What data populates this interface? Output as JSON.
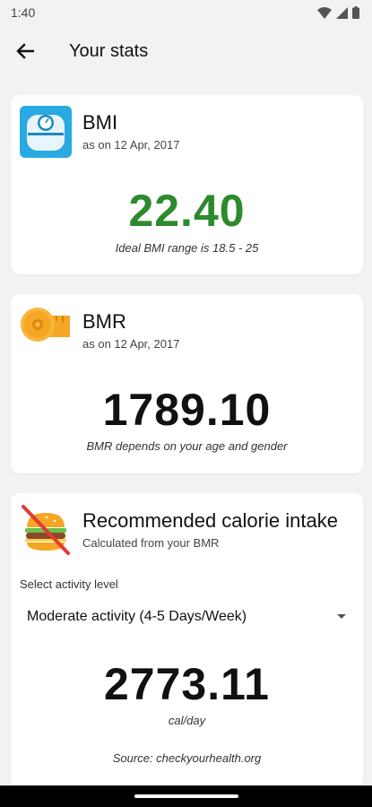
{
  "status_bar": {
    "time": "1:40"
  },
  "app_bar": {
    "title": "Your stats"
  },
  "bmi": {
    "title": "BMI",
    "date": "as on 12 Apr, 2017",
    "value": "22.40",
    "caption": "Ideal BMI range is 18.5 - 25",
    "value_color": "#2d8a2d"
  },
  "bmr": {
    "title": "BMR",
    "date": "as on 12 Apr, 2017",
    "value": "1789.10",
    "caption": "BMR depends on your age and gender"
  },
  "calorie": {
    "title": "Recommended calorie intake",
    "subtitle": "Calculated from your BMR",
    "select_label": "Select activity level",
    "activity": "Moderate activity (4-5 Days/Week)",
    "value": "2773.11",
    "unit": "cal/day",
    "source": "Source: checkyourhealth.org"
  },
  "icons": {
    "back": "arrow-back-icon",
    "bmi": "weighing-scale-icon",
    "bmr": "measuring-tape-icon",
    "calorie": "no-burger-icon",
    "dropdown": "caret-down-icon"
  }
}
